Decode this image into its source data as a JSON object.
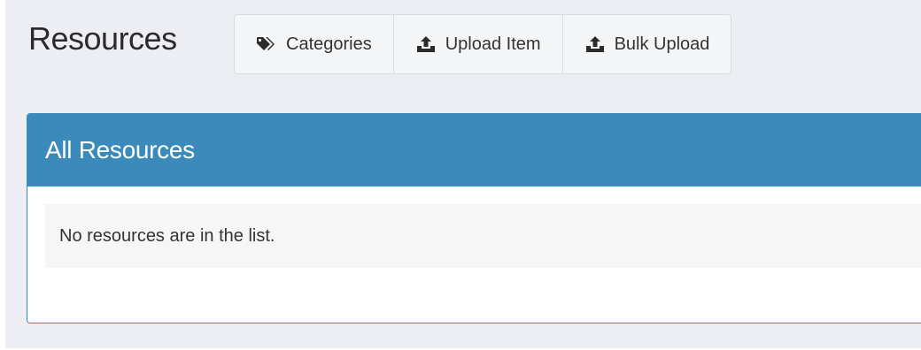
{
  "page": {
    "title": "Resources"
  },
  "toolbar": {
    "buttons": [
      {
        "label": "Categories",
        "icon": "tags-icon"
      },
      {
        "label": "Upload Item",
        "icon": "upload-icon"
      },
      {
        "label": "Bulk Upload",
        "icon": "upload-icon"
      }
    ]
  },
  "panel": {
    "title": "All Resources",
    "empty_message": "No resources are in the list."
  },
  "colors": {
    "page_bg": "#eceef3",
    "panel_header": "#3a8bbb",
    "button_bg": "#f4f5f7"
  }
}
